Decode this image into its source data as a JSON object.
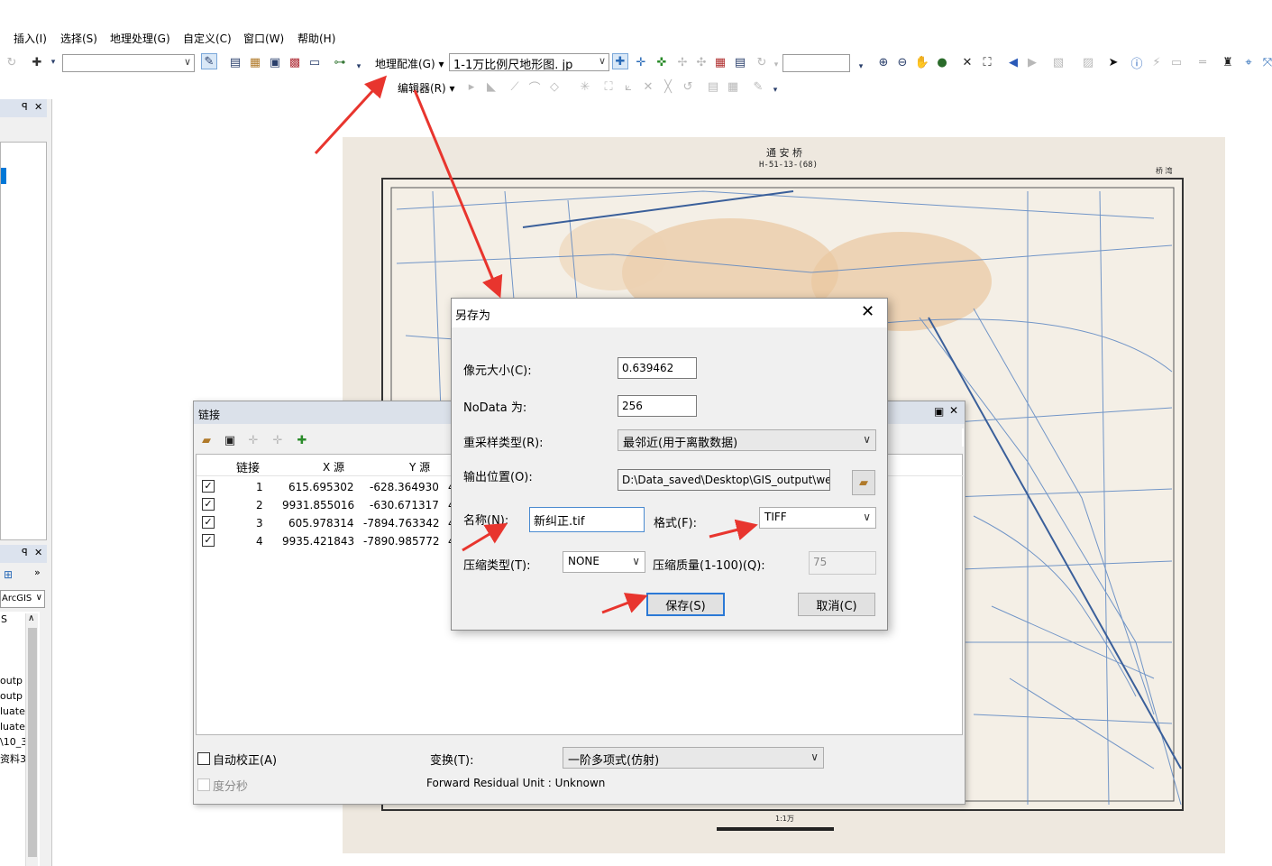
{
  "menu": [
    "插入(I)",
    "选择(S)",
    "地理处理(G)",
    "自定义(C)",
    "窗口(W)",
    "帮助(H)"
  ],
  "toolbar": {
    "georef_label": "地理配准(G)",
    "layer_combo": "1-1万比例尺地形图. jp",
    "editor_label": "编辑器(R)"
  },
  "left_panel": {
    "combo_text": "ArcGIS",
    "tree_top": "S",
    "tree_items": [
      "outp",
      "outp",
      "luate",
      "luate",
      "\\10_3",
      "资料3"
    ]
  },
  "map": {
    "title": "通 安 桥",
    "code": "H-51-13-(68)",
    "corner": "桥 湾",
    "scale_label": "1:1万"
  },
  "link_dialog": {
    "title": "链接",
    "columns": [
      "链接",
      "X 源",
      "Y 源"
    ],
    "rows": [
      {
        "checked": true,
        "id": "1",
        "x": "615.695302",
        "y": "-628.364930",
        "extra": "4"
      },
      {
        "checked": true,
        "id": "2",
        "x": "9931.855016",
        "y": "-630.671317",
        "extra": "4"
      },
      {
        "checked": true,
        "id": "3",
        "x": "605.978314",
        "y": "-7894.763342",
        "extra": "4"
      },
      {
        "checked": true,
        "id": "4",
        "x": "9935.421843",
        "y": "-7890.985772",
        "extra": "4"
      }
    ],
    "auto_correct": "自动校正(A)",
    "auto_correct_checked": false,
    "dms": "度分秒",
    "transform_label": "变换(T):",
    "transform_value": "一阶多项式(仿射)",
    "residual": "Forward Residual Unit : Unknown"
  },
  "save_dialog": {
    "title": "另存为",
    "cell_size_label": "像元大小(C):",
    "cell_size_value": "0.639462",
    "nodata_label": "NoData 为:",
    "nodata_value": "256",
    "resample_label": "重采样类型(R):",
    "resample_value": "最邻近(用于离散数据)",
    "output_label": "输出位置(O):",
    "output_value": "D:\\Data_saved\\Desktop\\GIS_output\\wee",
    "name_label": "名称(N):",
    "name_value": "新纠正.tif",
    "format_label": "格式(F):",
    "format_value": "TIFF",
    "compress_label": "压缩类型(T):",
    "compress_value": "NONE",
    "quality_label": "压缩质量(1-100)(Q):",
    "quality_value": "75",
    "save_button": "保存(S)",
    "cancel_button": "取消(C)"
  },
  "colors": {
    "annotation_arrow": "#e8352e",
    "selection_blue": "#0078d7",
    "map_water": "#5b86c2",
    "map_paper": "#eee8df"
  }
}
